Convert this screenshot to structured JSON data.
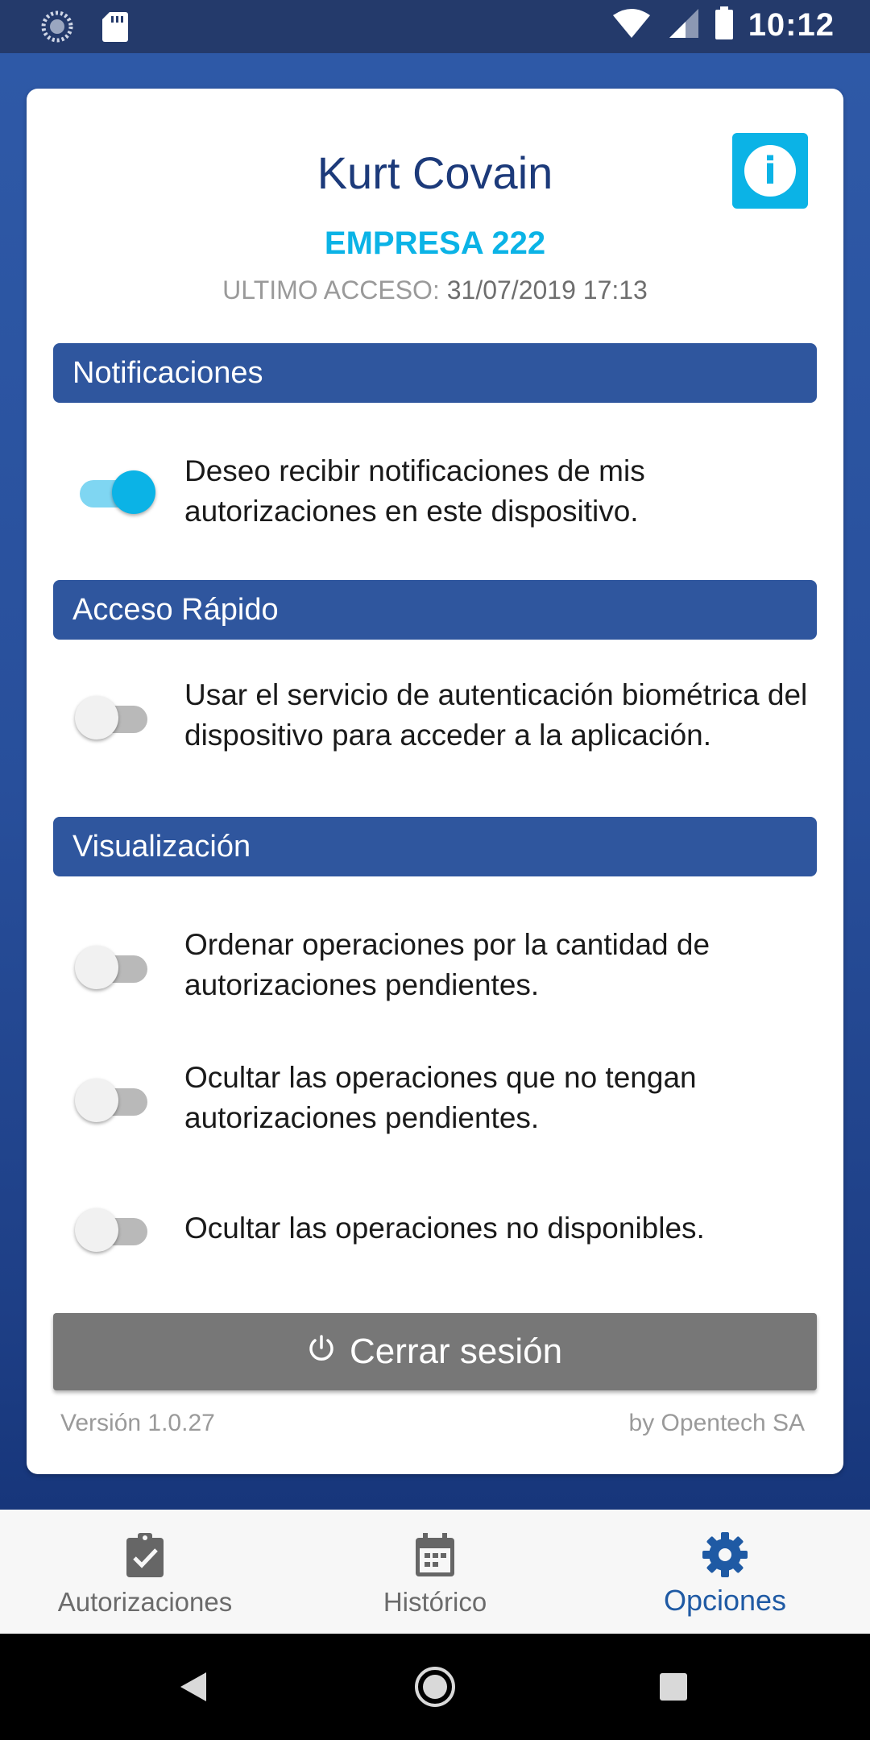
{
  "status_bar": {
    "time": "10:12",
    "icons": [
      "sync-icon",
      "sd-card-icon",
      "wifi-icon",
      "signal-icon",
      "battery-icon"
    ]
  },
  "profile": {
    "name": "Kurt Covain",
    "company": "EMPRESA 222",
    "last_access_label": "ULTIMO ACCESO:",
    "last_access_value": "31/07/2019 17:13",
    "info_icon": "info-icon"
  },
  "sections": {
    "notifications": {
      "title": "Notificaciones",
      "option_text": "Deseo recibir notificaciones de mis autorizaciones en este dispositivo.",
      "enabled": true
    },
    "quick_access": {
      "title": "Acceso Rápido",
      "option_text": "Usar el servicio de autenticación biométrica del dispositivo para acceder a la aplicación.",
      "enabled": false
    },
    "display": {
      "title": "Visualización",
      "options": [
        {
          "text": "Ordenar operaciones por la cantidad de autorizaciones pendientes.",
          "enabled": false
        },
        {
          "text": "Ocultar las operaciones que no tengan autorizaciones pendientes.",
          "enabled": false
        },
        {
          "text": "Ocultar las operaciones no disponibles.",
          "enabled": false
        }
      ]
    }
  },
  "logout": {
    "label": "Cerrar sesión",
    "icon": "power-icon"
  },
  "footer": {
    "version": "Versión 1.0.27",
    "credit": "by Opentech SA"
  },
  "bottom_nav": [
    {
      "label": "Autorizaciones",
      "icon": "clipboard-check-icon",
      "active": false
    },
    {
      "label": "Histórico",
      "icon": "calendar-icon",
      "active": false
    },
    {
      "label": "Opciones",
      "icon": "gear-icon",
      "active": true
    }
  ],
  "colors": {
    "primary_dark": "#2f569e",
    "accent": "#0bb3e6",
    "active_nav": "#1f5aa4",
    "logout_bg": "#777777"
  }
}
